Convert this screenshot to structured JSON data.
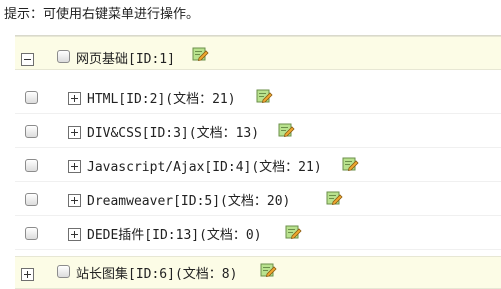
{
  "hint": "提示：可使用右键菜单进行操作。",
  "tree": {
    "root": {
      "label": "网页基础[ID:1]",
      "expanded": true
    },
    "children": [
      {
        "label": "HTML[ID:2](文档：21)"
      },
      {
        "label": "DIV&CSS[ID:3](文档：13)"
      },
      {
        "label": "Javascript/Ajax[ID:4](文档：21)"
      },
      {
        "label": "Dreamweaver[ID:5](文档：20)"
      },
      {
        "label": "DEDE插件[ID:13](文档：0)"
      }
    ],
    "sibling": {
      "label": "站长图集[ID:6](文档：8)",
      "expanded": false
    }
  },
  "icons": {
    "collapse": "minus-box-icon",
    "expand": "plus-box-icon",
    "edit": "edit-pencil-icon"
  },
  "colors": {
    "parent_row_bg": "#fcfce6",
    "edit_icon_bg": "#b9e28e",
    "edit_icon_pencil": "#f0a830"
  }
}
